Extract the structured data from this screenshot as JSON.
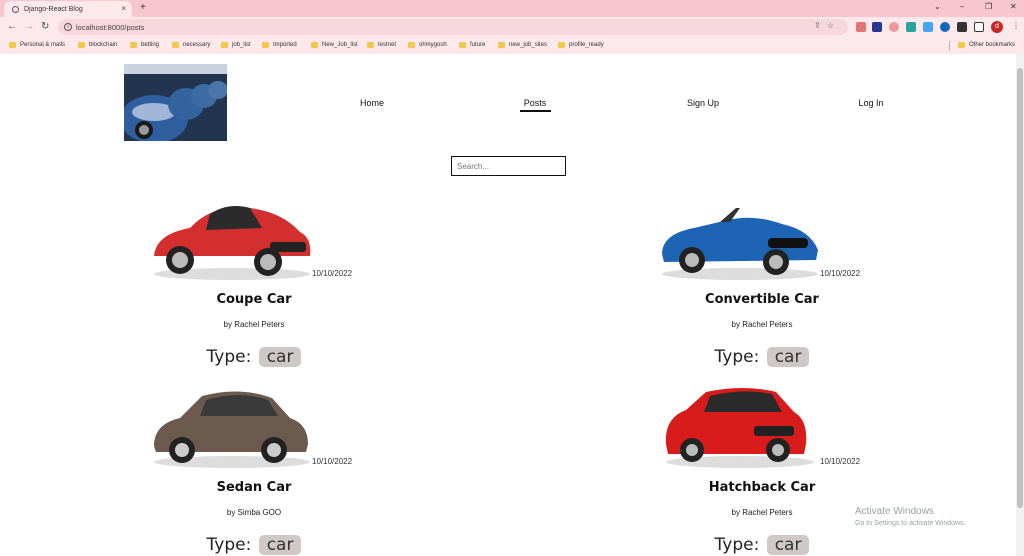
{
  "browser": {
    "tab_title": "Django-React Blog",
    "new_tab": "+",
    "close_tab": "×",
    "url": "localhost:8000/posts",
    "profile_initial": "d",
    "bookmarks": [
      "Personal & mails",
      "blockchain",
      "betting",
      "necessary",
      "job_list",
      "Imported",
      "New_Job_list",
      "testnet",
      "ohmygosh",
      "future",
      "new_job_sites",
      "profile_ready"
    ],
    "other_bookmarks": "Other bookmarks"
  },
  "nav": {
    "home": "Home",
    "posts": "Posts",
    "signup": "Sign Up",
    "login": "Log In"
  },
  "search": {
    "placeholder": "Search..."
  },
  "posts": [
    {
      "title": "Coupe Car",
      "date": "10/10/2022",
      "author": "by Rachel Peters",
      "type_label": "Type:",
      "type": "car"
    },
    {
      "title": "Convertible Car",
      "date": "10/10/2022",
      "author": "by Rachel Peters",
      "type_label": "Type:",
      "type": "car"
    },
    {
      "title": "Sedan Car",
      "date": "10/10/2022",
      "author": "by Simba GOO",
      "type_label": "Type:",
      "type": "car"
    },
    {
      "title": "Hatchback Car",
      "date": "10/10/2022",
      "author": "by Rachel Peters",
      "type_label": "Type:",
      "type": "car"
    }
  ],
  "watermark": {
    "title": "Activate Windows",
    "subtitle": "Go to Settings to activate Windows."
  },
  "colors": {
    "chrome_bg": "#f7c6cf",
    "type_badge": "#cfc8c6",
    "coupe": "#d32f2f",
    "convertible": "#1e64b4",
    "sedan": "#6d5a4e",
    "hatchback": "#d81b1b"
  }
}
